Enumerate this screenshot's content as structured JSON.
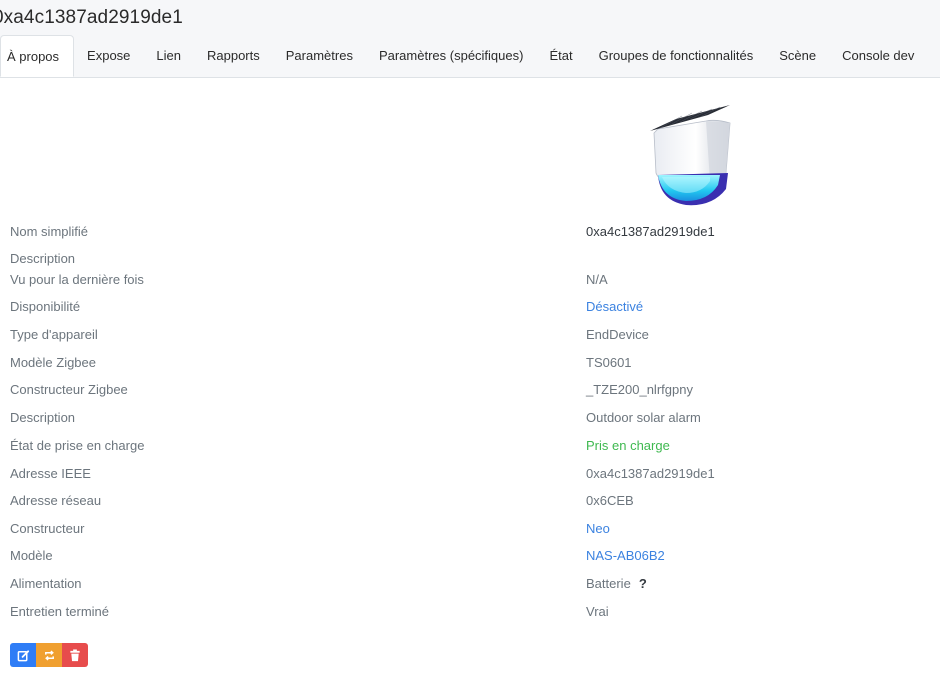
{
  "title": "0xa4c1387ad2919de1",
  "tabs": [
    {
      "label": "À propos"
    },
    {
      "label": "Expose"
    },
    {
      "label": "Lien"
    },
    {
      "label": "Rapports"
    },
    {
      "label": "Paramètres"
    },
    {
      "label": "Paramètres (spécifiques)"
    },
    {
      "label": "État"
    },
    {
      "label": "Groupes de fonctionnalités"
    },
    {
      "label": "Scène"
    },
    {
      "label": "Console dev"
    }
  ],
  "active_tab": "À propos",
  "device_image": {
    "icon": "solar-alarm-siren-device-image"
  },
  "info": [
    {
      "label": "Nom simplifié",
      "value": "0xa4c1387ad2919de1"
    },
    {
      "label": "Description",
      "value": ""
    },
    {
      "label": "Vu pour la dernière fois",
      "value": "N/A"
    },
    {
      "label": "Disponibilité",
      "value": "Désactivé"
    },
    {
      "label": "Type d'appareil",
      "value": "EndDevice"
    },
    {
      "label": "Modèle Zigbee",
      "value": "TS0601"
    },
    {
      "label": "Constructeur Zigbee",
      "value": "_TZE200_nlrfgpny"
    },
    {
      "label": "Description",
      "value": "Outdoor solar alarm"
    },
    {
      "label": "État de prise en charge",
      "value": "Pris en charge"
    },
    {
      "label": "Adresse IEEE",
      "value": "0xa4c1387ad2919de1"
    },
    {
      "label": "Adresse réseau",
      "value": "0x6CEB"
    },
    {
      "label": "Constructeur",
      "value": "Neo"
    },
    {
      "label": "Modèle",
      "value": "NAS-AB06B2"
    },
    {
      "label": "Alimentation",
      "value": "Batterie",
      "help": "?"
    },
    {
      "label": "Entretien terminé",
      "value": "Vrai"
    }
  ],
  "actions": [
    {
      "name": "edit-button",
      "icon": "edit-icon"
    },
    {
      "name": "rename-button",
      "icon": "refresh-icon"
    },
    {
      "name": "delete-button",
      "icon": "trash-icon"
    }
  ],
  "colors": {
    "link": "#3b82e0",
    "supported": "#3fb950",
    "edit": "#2f7df6",
    "rename": "#f0a030",
    "delete": "#e74c4c"
  }
}
